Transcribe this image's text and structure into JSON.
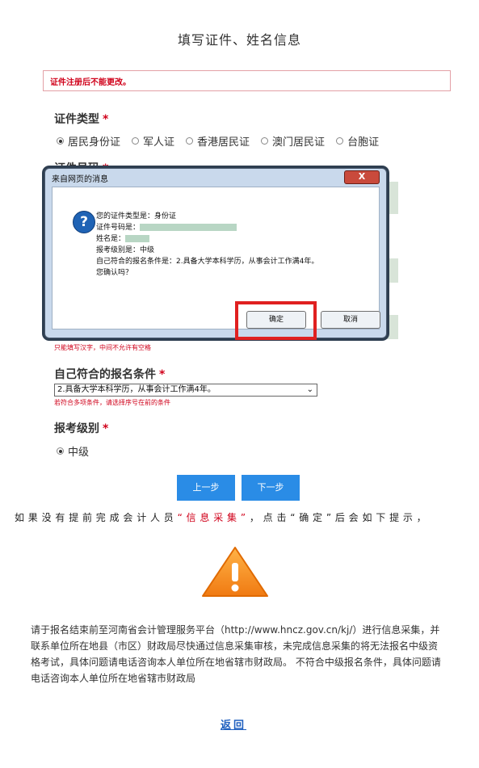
{
  "page": {
    "title": "填写证件、姓名信息"
  },
  "warning": {
    "text": "证件注册后不能更改。"
  },
  "id_type": {
    "label": "证件类型",
    "required_mark": "*",
    "options": [
      "居民身份证",
      "军人证",
      "香港居民证",
      "澳门居民证",
      "台胞证"
    ],
    "selected": "居民身份证"
  },
  "id_number": {
    "label": "证件号码",
    "required_mark": "*"
  },
  "dialog": {
    "title": "来自网页的消息",
    "close_label": "X",
    "icon": "question-icon",
    "lines": {
      "doc_type": "您的证件类型是：身份证",
      "doc_number": "证件号码是：",
      "name": "姓名是：",
      "level": "报考级别是：中级",
      "condition": "自己符合的报名条件是：2.具备大学本科学历，从事会计工作满4年。",
      "confirm": "您确认吗？"
    },
    "ok_label": "确定",
    "cancel_label": "取消"
  },
  "name_hint": "只能填写汉字，中间不允许有空格",
  "condition": {
    "label": "自己符合的报名条件",
    "required_mark": "*",
    "selected": "2.具备大学本科学历，从事会计工作满4年。",
    "hint": "若符合多项条件，请选择序号在前的条件"
  },
  "level": {
    "label": "报考级别",
    "required_mark": "*",
    "option": "中级"
  },
  "buttons": {
    "prev": "上一步",
    "next": "下一步"
  },
  "explain": {
    "before": "如果没有提前完成会计人员",
    "highlight": "“信息采集”",
    "after": "，点击“确定”后会如下提示，"
  },
  "notice": {
    "text": "请于报名结束前至河南省会计管理服务平台（http://www.hncz.gov.cn/kj/）进行信息采集，并联系单位所在地县（市区）财政局尽快通过信息采集审核，未完成信息采集的将无法报名中级资格考试，具体问题请电话咨询本人单位所在地省辖市财政局。 不符合中级报名条件，具体问题请电话咨询本人单位所在地省辖市财政局"
  },
  "back": {
    "label": "返回"
  },
  "colors": {
    "accent_blue": "#2a8ce6",
    "required_red": "#d0021b",
    "highlight_box": "#e02020"
  }
}
